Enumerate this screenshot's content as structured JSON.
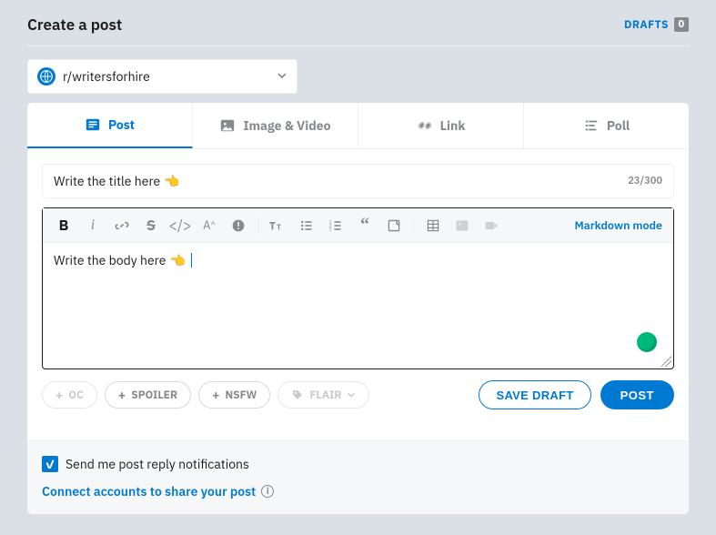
{
  "header": {
    "title": "Create a post",
    "drafts_label": "DRAFTS",
    "drafts_count": "0"
  },
  "community": {
    "name": "r/writersforhire"
  },
  "tabs": {
    "post": "Post",
    "image_video": "Image & Video",
    "link": "Link",
    "poll": "Poll"
  },
  "title_field": {
    "value": "Write the title here",
    "counter": "23/300"
  },
  "toolbar": {
    "markdown_mode": "Markdown mode"
  },
  "editor": {
    "body_text": "Write the body here"
  },
  "tags": {
    "oc": "OC",
    "spoiler": "SPOILER",
    "nsfw": "NSFW",
    "flair": "FLAIR"
  },
  "actions": {
    "save_draft": "SAVE DRAFT",
    "post": "POST"
  },
  "footer": {
    "notify_label": "Send me post reply notifications",
    "connect_label": "Connect accounts to share your post"
  }
}
